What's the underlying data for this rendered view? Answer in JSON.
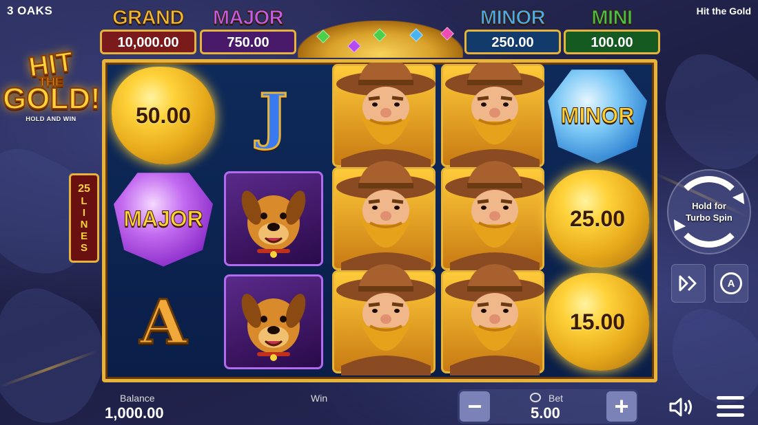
{
  "brand": "3 OAKS",
  "game_name": "Hit the Gold",
  "jackpots": [
    {
      "label": "GRAND",
      "value": "10,000.00"
    },
    {
      "label": "MAJOR",
      "value": "750.00"
    },
    {
      "label": "MINOR",
      "value": "250.00"
    },
    {
      "label": "MINI",
      "value": "100.00"
    }
  ],
  "logo": {
    "line1": "HIT",
    "line2": "THE",
    "line3": "GOLD!",
    "sub": "HOLD AND WIN"
  },
  "lines": {
    "count": "25",
    "word": "LINES"
  },
  "reels": {
    "r1c1": "50.00",
    "r1c2": "J",
    "r1c5": "MINOR",
    "r2c1": "MAJOR",
    "r2c5": "25.00",
    "r3c1": "A",
    "r3c5": "15.00"
  },
  "controls": {
    "spin_hint_line1": "Hold for",
    "spin_hint_line2": "Turbo Spin",
    "auto_label": "A"
  },
  "footer": {
    "balance_label": "Balance",
    "balance_value": "1,000.00",
    "win_label": "Win",
    "bet_label": "Bet",
    "bet_value": "5.00",
    "minus": "−",
    "plus": "+"
  },
  "colors": {
    "accent_gold": "#e6b43a",
    "reel_bg": "#0e2a5a"
  }
}
